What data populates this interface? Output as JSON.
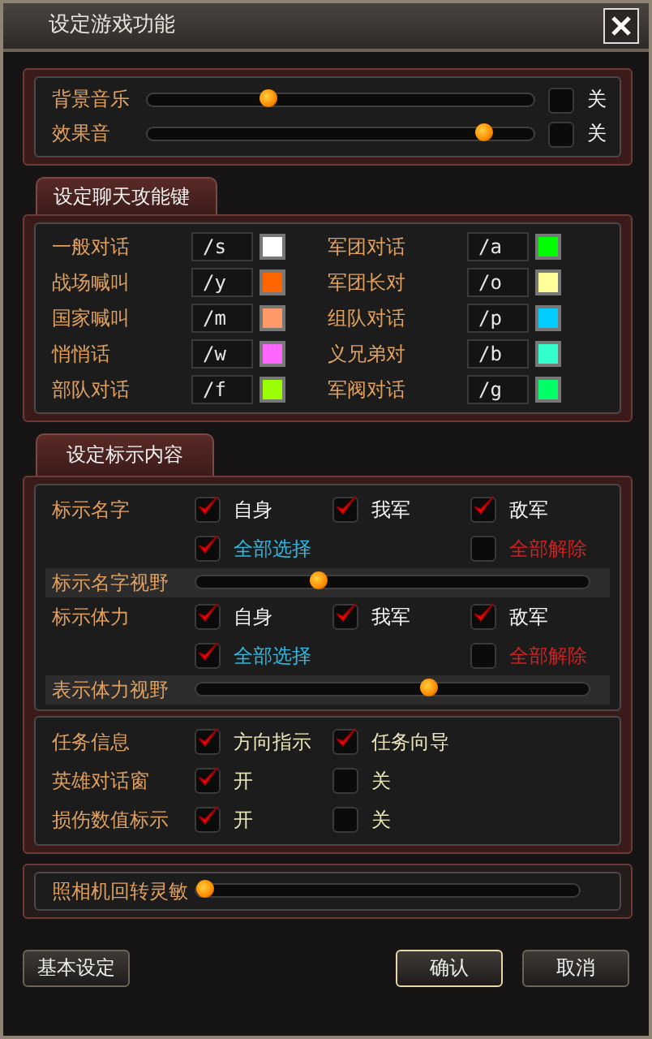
{
  "window": {
    "title": "设定游戏功能"
  },
  "sound": [
    {
      "label": "背景音乐",
      "level": 0.31,
      "muted": false,
      "mute_label": "关"
    },
    {
      "label": "效果音",
      "level": 0.87,
      "muted": false,
      "mute_label": "关"
    }
  ],
  "chat_tab": {
    "label": "设定聊天攻能键",
    "selected": true
  },
  "chat_keys": [
    {
      "label": "一般对话",
      "command": "/s",
      "color": "#ffffff"
    },
    {
      "label": "军团对话",
      "command": "/a",
      "color": "#00ff00"
    },
    {
      "label": "战场喊叫",
      "command": "/y",
      "color": "#ff6600"
    },
    {
      "label": "军团长对",
      "command": "/o",
      "color": "#ffff99"
    },
    {
      "label": "国家喊叫",
      "command": "/m",
      "color": "#ff9966"
    },
    {
      "label": "组队对话",
      "command": "/p",
      "color": "#00ccff"
    },
    {
      "label": "悄悄话",
      "command": "/w",
      "color": "#ff66ff"
    },
    {
      "label": "义兄弟对",
      "command": "/b",
      "color": "#33ffcc"
    },
    {
      "label": "部队对话",
      "command": "/f",
      "color": "#99ff00"
    },
    {
      "label": "军阀对话",
      "command": "/g",
      "color": "#00ff66"
    }
  ],
  "display_tab": {
    "label": "设定标示内容",
    "selected": true
  },
  "display_groups": [
    {
      "label": "标示名字",
      "options": [
        {
          "label": "自身",
          "checked": true
        },
        {
          "label": "我军",
          "checked": true
        },
        {
          "label": "敌军",
          "checked": true
        }
      ],
      "select_all": {
        "label": "全部选择",
        "checked": true
      },
      "clear_all": {
        "label": "全部解除",
        "checked": false
      },
      "range": {
        "label": "标示名字视野",
        "level": 0.31
      }
    },
    {
      "label": "标示体力",
      "options": [
        {
          "label": "自身",
          "checked": true
        },
        {
          "label": "我军",
          "checked": true
        },
        {
          "label": "敌军",
          "checked": true
        }
      ],
      "select_all": {
        "label": "全部选择",
        "checked": true
      },
      "clear_all": {
        "label": "全部解除",
        "checked": false
      },
      "range": {
        "label": "表示体力视野",
        "level": 0.59
      }
    }
  ],
  "misc": [
    {
      "label": "任务信息",
      "options": [
        {
          "label": "方向指示",
          "checked": true
        },
        {
          "label": "任务向导",
          "checked": true
        }
      ]
    },
    {
      "label": "英雄对话窗",
      "options": [
        {
          "label": "开",
          "checked": true
        },
        {
          "label": "关",
          "checked": false
        }
      ]
    },
    {
      "label": "损伤数值标示",
      "options": [
        {
          "label": "开",
          "checked": true
        },
        {
          "label": "关",
          "checked": false
        }
      ]
    }
  ],
  "camera": {
    "label": "照相机回转灵敏",
    "level": 0.02
  },
  "buttons": [
    {
      "label": "基本设定",
      "selected": false
    },
    {
      "label": "确认",
      "selected": true
    },
    {
      "label": "取消",
      "selected": false
    }
  ]
}
